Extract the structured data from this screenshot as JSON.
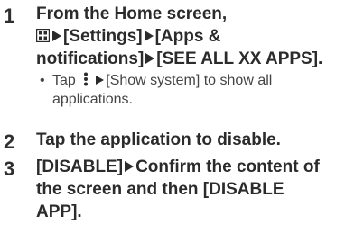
{
  "steps": [
    {
      "number": "1",
      "line1": "From the Home screen,",
      "line2_items": [
        "[Settings]",
        "[Apps &"
      ],
      "line3": "notifications]",
      "line3_item": "[SEE ALL XX APPS]."
    },
    {
      "number": "2",
      "text": "Tap the application to disable."
    },
    {
      "number": "3",
      "line1_a": "[DISABLE]",
      "line1_b": "Confirm the content of",
      "line2": "the screen and then [DISABLE",
      "line3": "APP]."
    }
  ],
  "note": {
    "tap": "Tap",
    "show_system": "[Show system] to show all",
    "continuation": "applications."
  },
  "icons": {
    "apps": "apps-grid-icon",
    "menu": "overflow-menu-icon",
    "arrow": "triangle-right-icon"
  }
}
